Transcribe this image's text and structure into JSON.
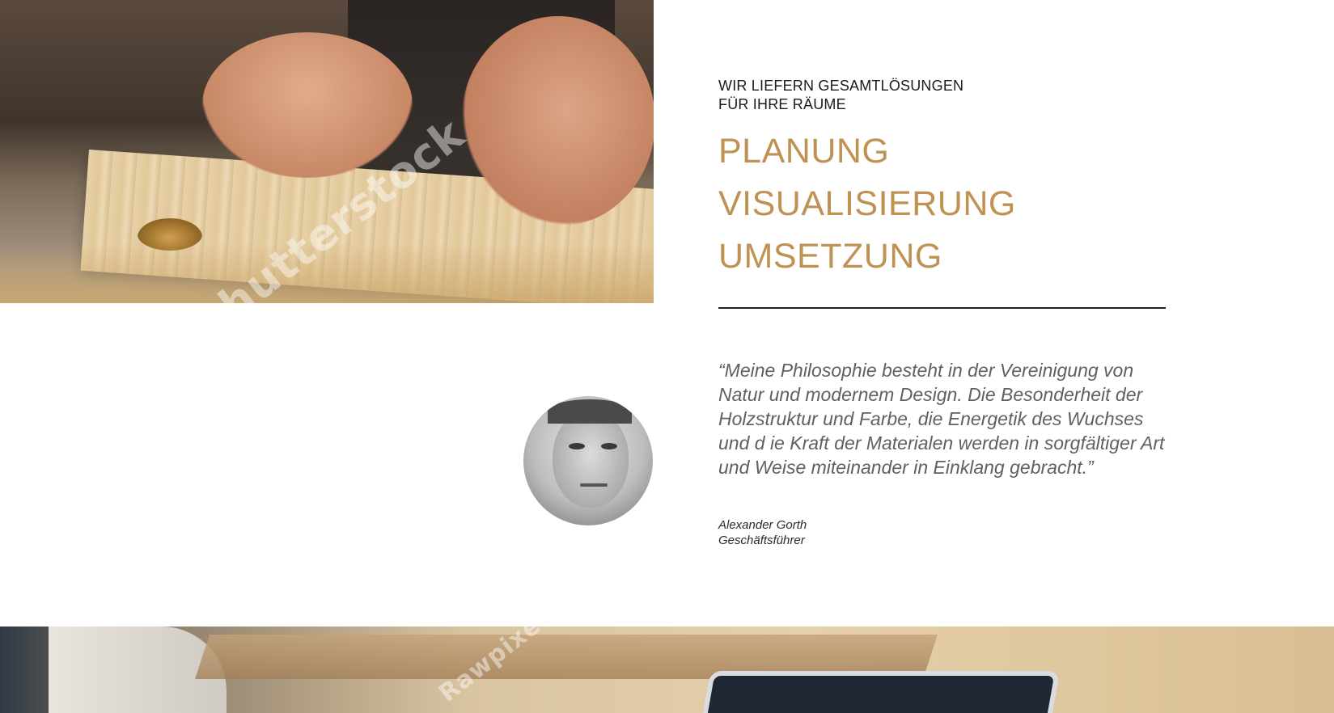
{
  "hero": {
    "image_alt": "Schreiner bearbeitet Holzleiste mit Oberfräse",
    "watermark": "shutterstock"
  },
  "intro": {
    "eyebrow_line1": "WIR LIEFERN GESAMTLÖSUNGEN",
    "eyebrow_line2": "FÜR IHRE RÄUME"
  },
  "services": [
    "PLANUNG",
    "VISUALISIERUNG",
    "UMSETZUNG"
  ],
  "testimonial": {
    "quote": "“Meine Philosophie besteht in der Vereinigung von Natur und modernem Design. Die Besonderheit der Holzstruktur und Farbe, die Energetik des Wuchses und d ie Kraft der Materialen werden in sorgfältiger Art und Weise miteinander in Einklang gebracht.”",
    "author_name": "Alexander Gorth",
    "author_role": "Geschäftsführer"
  },
  "bottom_band": {
    "watermark": "Rawpixel"
  },
  "colors": {
    "accent_gold": "#bf9254",
    "text_dark": "#1b1b1b",
    "quote_gray": "#606060"
  }
}
